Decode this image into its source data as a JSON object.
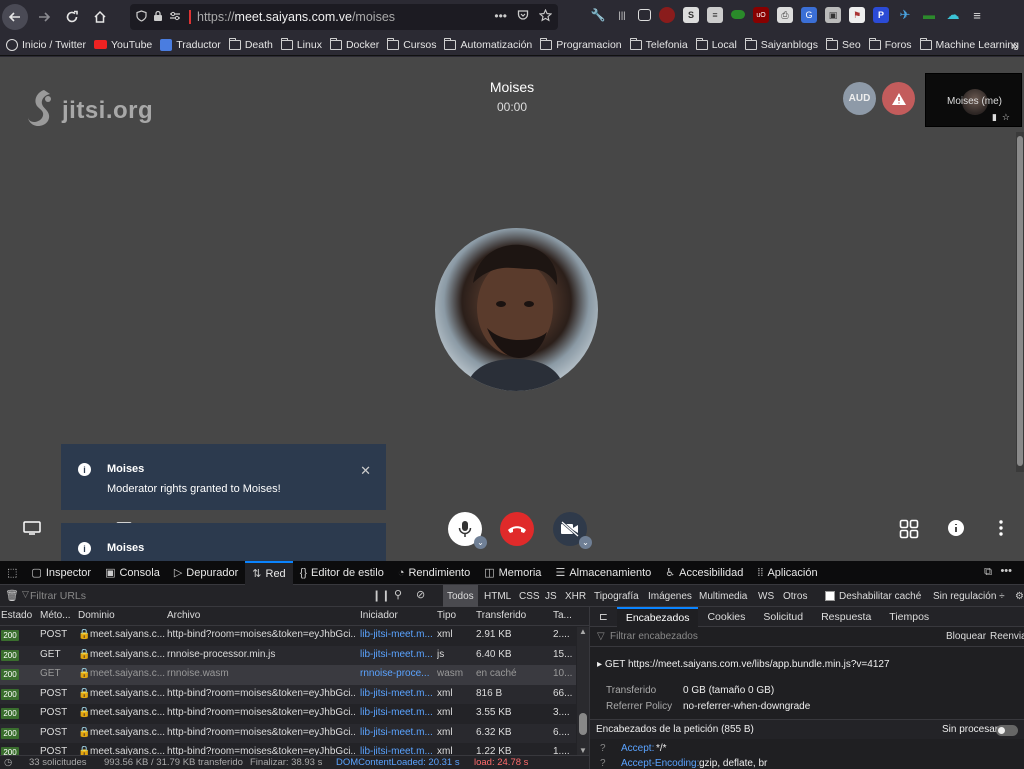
{
  "browser": {
    "url_prefix": "https://",
    "url_host": "meet.saiyans.com.ve",
    "url_path": "/moises",
    "url_dots": "•••"
  },
  "bookmarks": [
    {
      "label": "Inicio / Twitter",
      "icon": "globe-icon"
    },
    {
      "label": "YouTube",
      "icon": "youtube-icon"
    },
    {
      "label": "Traductor",
      "icon": "google-translate-icon"
    },
    {
      "label": "Death",
      "icon": "folder-icon"
    },
    {
      "label": "Linux",
      "icon": "folder-icon"
    },
    {
      "label": "Docker",
      "icon": "folder-icon"
    },
    {
      "label": "Cursos",
      "icon": "folder-icon"
    },
    {
      "label": "Automatización",
      "icon": "folder-icon"
    },
    {
      "label": "Programacion",
      "icon": "folder-icon"
    },
    {
      "label": "Telefonia",
      "icon": "folder-icon"
    },
    {
      "label": "Local",
      "icon": "folder-icon"
    },
    {
      "label": "Saiyanblogs",
      "icon": "folder-icon"
    },
    {
      "label": "Seo",
      "icon": "folder-icon"
    },
    {
      "label": "Foros",
      "icon": "folder-icon"
    },
    {
      "label": "Machine Learning",
      "icon": "folder-icon"
    }
  ],
  "meeting": {
    "logo": "jitsi.org",
    "title": "Moises",
    "timer": "00:00",
    "aud_badge": "AUD",
    "self_name": "Moises (me)"
  },
  "notifications": [
    {
      "title": "Moises",
      "message": "Moderator rights granted to Moises!"
    },
    {
      "title": "Moises",
      "message": ""
    }
  ],
  "devtools": {
    "tabs": [
      "Inspector",
      "Consola",
      "Depurador",
      "Red",
      "Editor de estilo",
      "Rendimiento",
      "Memoria",
      "Almacenamiento",
      "Accesibilidad",
      "Aplicación"
    ],
    "active_tab": "Red",
    "filter_placeholder": "Filtrar URLs",
    "type_filters": [
      "Todos",
      "HTML",
      "CSS",
      "JS",
      "XHR",
      "Tipografía",
      "Imágenes",
      "Multimedia",
      "WS",
      "Otros"
    ],
    "disable_cache": "Deshabilitar caché",
    "throttling": "Sin regulación ÷",
    "columns": [
      "Estado",
      "Méto...",
      "Dominio",
      "Archivo",
      "Iniciador",
      "Tipo",
      "Transferido",
      "Ta..."
    ],
    "rows": [
      {
        "status": "200",
        "method": "POST",
        "domain": "meet.saiyans.c...",
        "file": "http-bind?room=moises&token=eyJhbGci...",
        "initiator": "lib-jitsi-meet.m...",
        "type": "xml",
        "transferred": "2.91 KB",
        "size": "2...."
      },
      {
        "status": "200",
        "method": "GET",
        "domain": "meet.saiyans.c...",
        "file": "rnnoise-processor.min.js",
        "initiator": "lib-jitsi-meet.m...",
        "type": "js",
        "transferred": "6.40 KB",
        "size": "15..."
      },
      {
        "status": "200",
        "method": "GET",
        "domain": "meet.saiyans.c...",
        "file": "rnnoise.wasm",
        "initiator": "rnnoise-proce...",
        "type": "wasm",
        "transferred": "en caché",
        "size": "10..."
      },
      {
        "status": "200",
        "method": "POST",
        "domain": "meet.saiyans.c...",
        "file": "http-bind?room=moises&token=eyJhbGci...",
        "initiator": "lib-jitsi-meet.m...",
        "type": "xml",
        "transferred": "816 B",
        "size": "66..."
      },
      {
        "status": "200",
        "method": "POST",
        "domain": "meet.saiyans.c...",
        "file": "http-bind?room=moises&token=eyJhbGci...",
        "initiator": "lib-jitsi-meet.m...",
        "type": "xml",
        "transferred": "3.55 KB",
        "size": "3...."
      },
      {
        "status": "200",
        "method": "POST",
        "domain": "meet.saiyans.c...",
        "file": "http-bind?room=moises&token=eyJhbGci...",
        "initiator": "lib-jitsi-meet.m...",
        "type": "xml",
        "transferred": "6.32 KB",
        "size": "6...."
      },
      {
        "status": "200",
        "method": "POST",
        "domain": "meet.saiyans.c...",
        "file": "http-bind?room=moises&token=eyJhbGci...",
        "initiator": "lib-jitsi-meet.m...",
        "type": "xml",
        "transferred": "1.22 KB",
        "size": "1...."
      }
    ],
    "status_bar": {
      "requests": "33 solicitudes",
      "size": "993.56 KB / 31.79 KB transferido",
      "finish": "Finalizar: 38.93 s",
      "dcl": "DOMContentLoaded: 20.31 s",
      "load": "load: 24.78 s"
    },
    "detail_tabs": [
      "Encabezados",
      "Cookies",
      "Solicitud",
      "Respuesta",
      "Tiempos"
    ],
    "detail_filter": "Filtrar encabezados",
    "block_btn": "Bloquear",
    "resend_btn": "Reenviar",
    "request_line": "GET  https://meet.saiyans.com.ve/libs/app.bundle.min.js?v=4127",
    "transferred_key": "Transferido",
    "transferred_val": "0 GB (tamaño 0 GB)",
    "referrer_key": "Referrer Policy",
    "referrer_val": "no-referrer-when-downgrade",
    "req_headers": "Encabezados de la petición (855 B)",
    "raw_toggle": "Sin procesar",
    "h1_key": "Accept:",
    "h1_val": "*/*",
    "h2_key": "Accept-Encoding:",
    "h2_val": "gzip, deflate, br"
  },
  "colors": {
    "accent": "#0a84ff",
    "hangup": "#e02a2a",
    "toast": "#2c3a4e"
  }
}
